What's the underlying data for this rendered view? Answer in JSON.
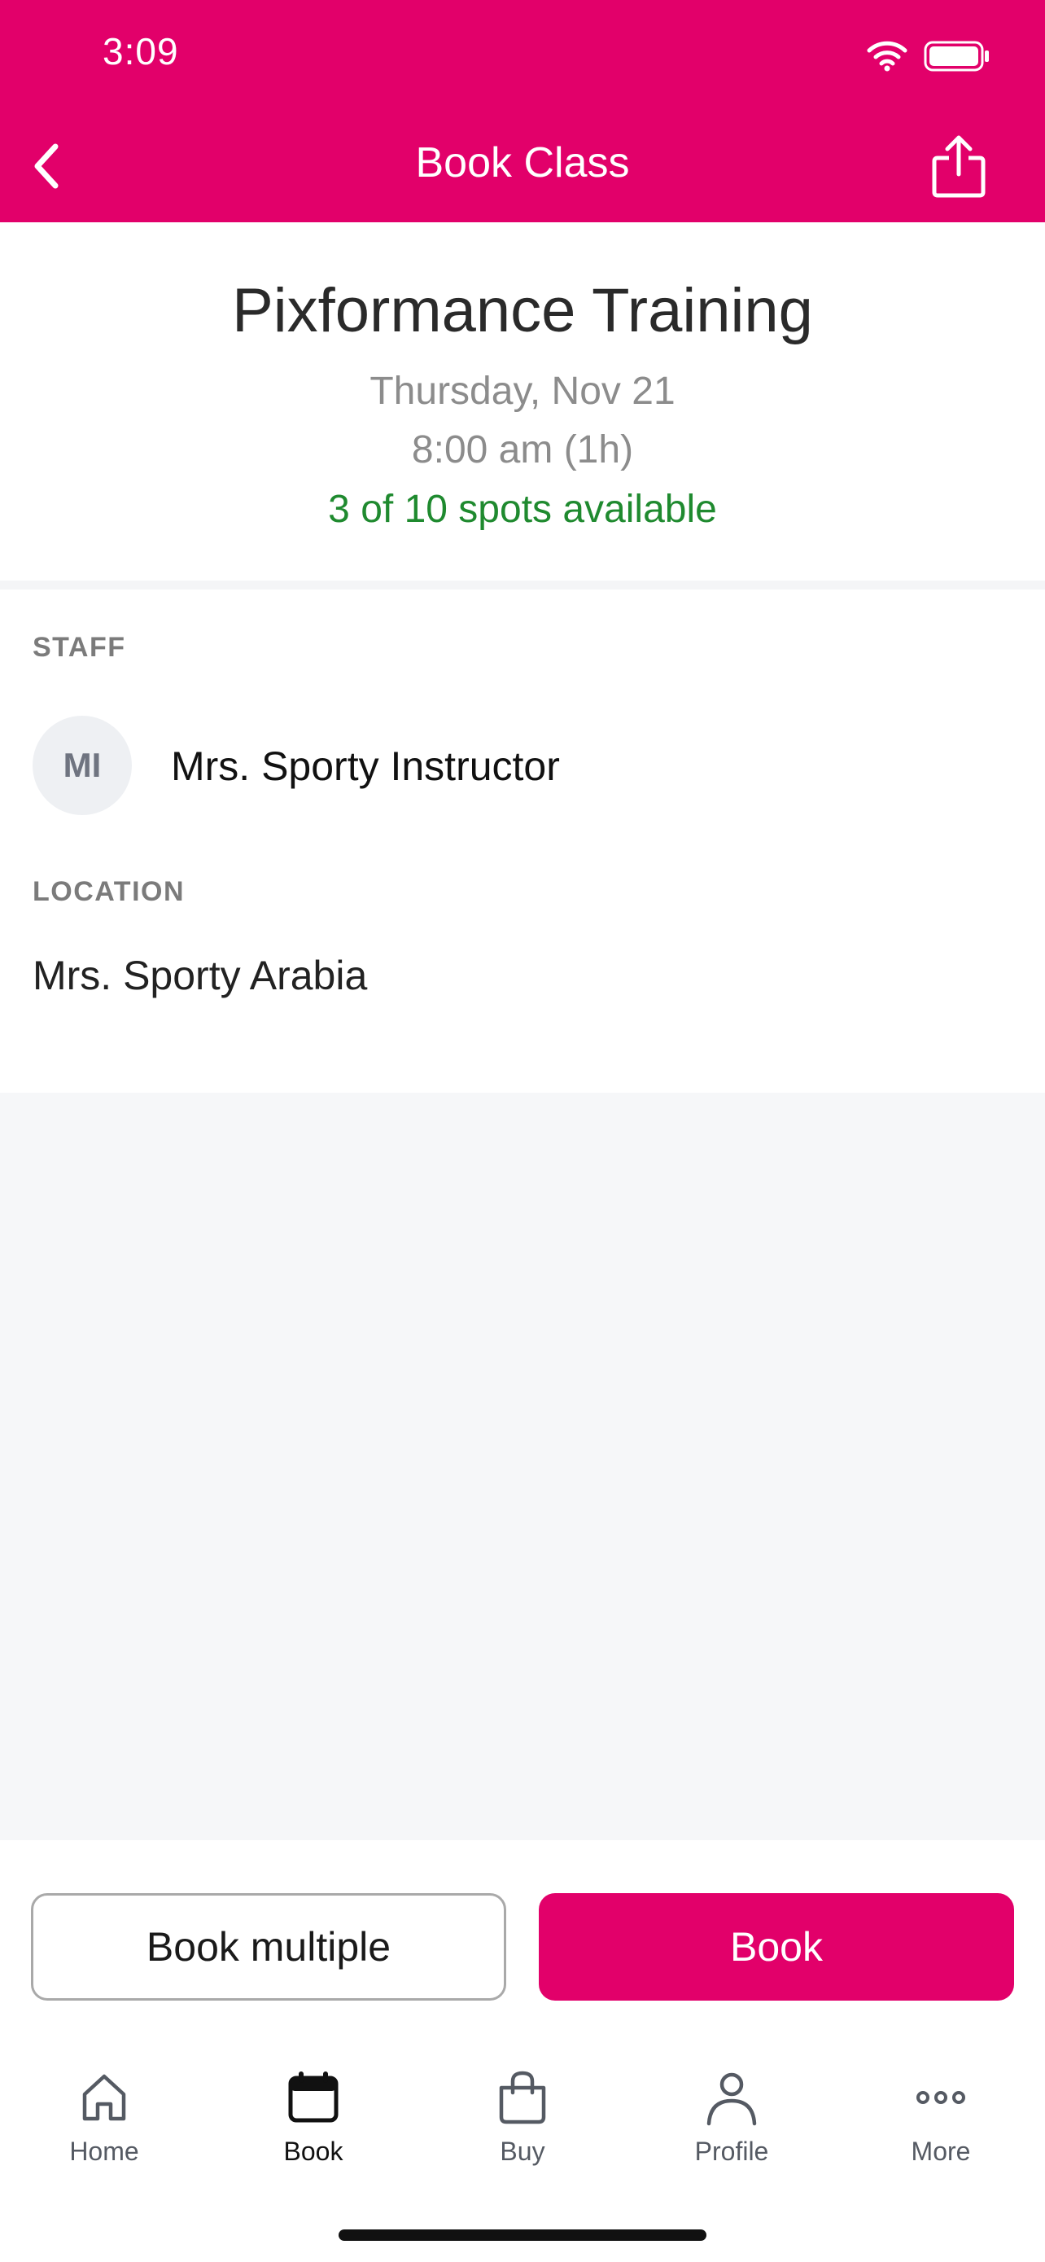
{
  "status_bar": {
    "time": "3:09"
  },
  "nav": {
    "title": "Book Class"
  },
  "class": {
    "title": "Pixformance Training",
    "date": "Thursday, Nov 21",
    "time": "8:00 am (1h)",
    "spots": "3 of 10 spots available"
  },
  "staff": {
    "label": "STAFF",
    "initials": "MI",
    "name": "Mrs. Sporty Instructor"
  },
  "location": {
    "label": "LOCATION",
    "name": "Mrs. Sporty Arabia"
  },
  "actions": {
    "book_multiple_label": "Book multiple",
    "book_label": "Book"
  },
  "tabs": [
    {
      "label": "Home",
      "icon": "home-icon",
      "active": false
    },
    {
      "label": "Book",
      "icon": "calendar-icon",
      "active": true
    },
    {
      "label": "Buy",
      "icon": "shopping-bag-icon",
      "active": false
    },
    {
      "label": "Profile",
      "icon": "person-icon",
      "active": false
    },
    {
      "label": "More",
      "icon": "more-icon",
      "active": false
    }
  ],
  "colors": {
    "brand": "#e2006a",
    "spots_available": "#1f8a2f",
    "muted_text": "#8c8c8c",
    "background": "#f6f7f9"
  }
}
